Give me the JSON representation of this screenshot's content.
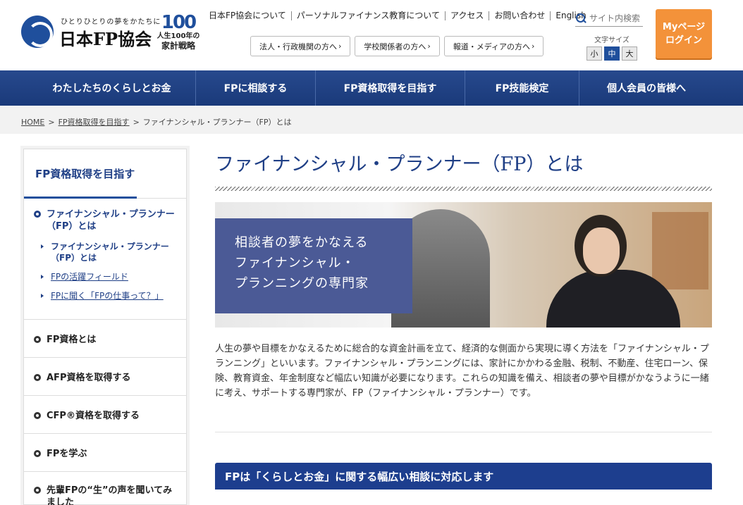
{
  "header": {
    "logo_tagline": "ひとりひとりの夢をかたちに",
    "logo_name": "日本FP協会",
    "badge_number": "100",
    "badge_line1": "人生100年の",
    "badge_line2": "家計戦略",
    "top_links": [
      "日本FP協会について",
      "パーソナルファイナンス教育について",
      "アクセス",
      "お問い合わせ",
      "English"
    ],
    "sub_buttons": [
      "法人・行政機関の方へ",
      "学校関係者の方へ",
      "報道・メディアの方へ"
    ],
    "search_placeholder": "サイト内検索",
    "font_size_label": "文字サイズ",
    "font_sizes": [
      "小",
      "中",
      "大"
    ],
    "font_size_selected": "中",
    "mypage_line1": "Myページ",
    "mypage_line2": "ログイン",
    "accent_color": "#f3923a",
    "brand_color": "#1f4f9c"
  },
  "nav": {
    "items": [
      "わたしたちのくらしとお金",
      "FPに相談する",
      "FP資格取得を目指す",
      "FP技能検定",
      "個人会員の皆様へ"
    ],
    "active": "FP資格取得を目指す"
  },
  "breadcrumb": {
    "home": "HOME",
    "parent": "FP資格取得を目指す",
    "current": "ファイナンシャル・プランナー（FP）とは",
    "separator": ">"
  },
  "sidebar": {
    "heading": "FP資格取得を目指す",
    "current_section": "ファイナンシャル・プランナー（FP）とは",
    "sub_items": [
      "ファイナンシャル・プランナー（FP）とは",
      "FPの活躍フィールド",
      "FPに聞く「FPの仕事って？」"
    ],
    "items": [
      "FP資格とは",
      "AFP資格を取得する",
      "CFP®資格を取得する",
      "FPを学ぶ",
      "先輩FPの“生”の声を聞いてみました"
    ]
  },
  "main": {
    "title": "ファイナンシャル・プランナー（FP）とは",
    "hero_lines": [
      "相談者の夢をかなえる",
      "ファイナンシャル・",
      "プランニングの専門家"
    ],
    "intro": "人生の夢や目標をかなえるために総合的な資金計画を立て、経済的な側面から実現に導く方法を「ファイナンシャル・プランニング」といいます。ファイナンシャル・プランニングには、家計にかかわる金融、税制、不動産、住宅ローン、保険、教育資金、年金制度など幅広い知識が必要になります。これらの知識を備え、相談者の夢や目標がかなうように一緒に考え、サポートする専門家が、FP（ファイナンシャル・プランナー）です。",
    "section_heading": "FPは「くらしとお金」に関する幅広い相談に対応します"
  }
}
